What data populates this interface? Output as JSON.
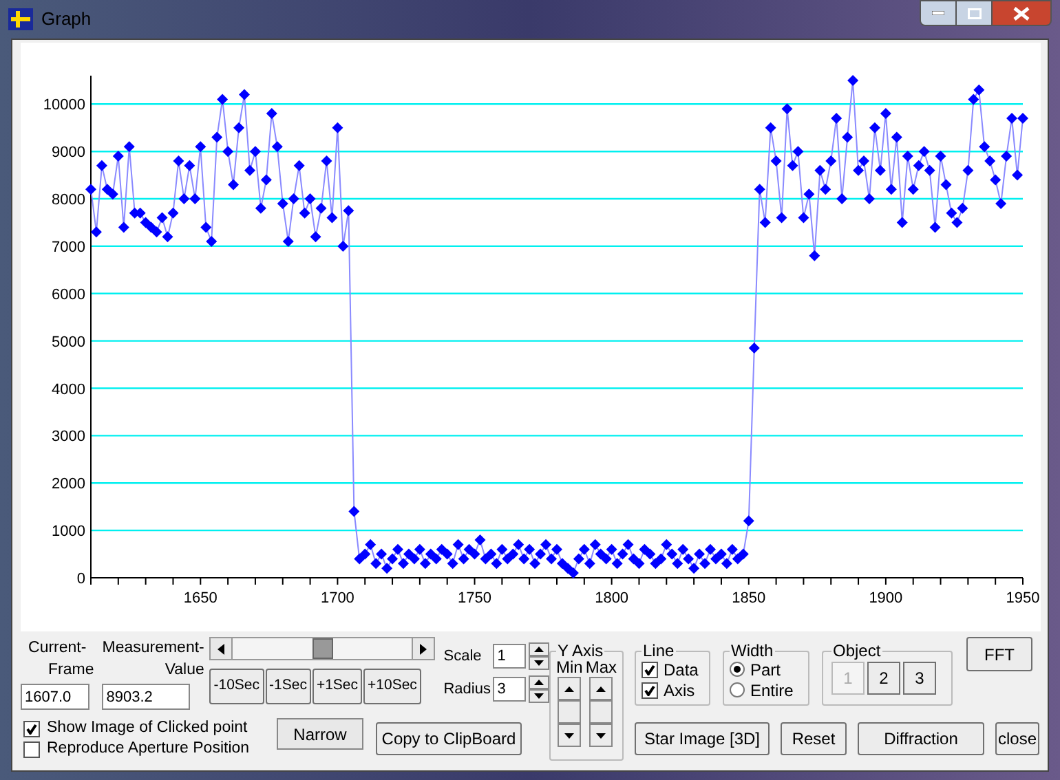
{
  "window": {
    "title": "Graph"
  },
  "graph": {
    "chart_data": {
      "type": "line",
      "grid": true,
      "xlim": [
        1610,
        1950
      ],
      "ylim": [
        0,
        10600
      ],
      "xticks": [
        1650,
        1700,
        1750,
        1800,
        1850,
        1900,
        1950
      ],
      "yticks": [
        0,
        1000,
        2000,
        3000,
        4000,
        5000,
        6000,
        7000,
        8000,
        9000,
        10000
      ],
      "x": [
        1610,
        1612,
        1614,
        1616,
        1618,
        1620,
        1622,
        1624,
        1626,
        1628,
        1630,
        1632,
        1634,
        1636,
        1638,
        1640,
        1642,
        1644,
        1646,
        1648,
        1650,
        1652,
        1654,
        1656,
        1658,
        1660,
        1662,
        1664,
        1666,
        1668,
        1670,
        1672,
        1674,
        1676,
        1678,
        1680,
        1682,
        1684,
        1686,
        1688,
        1690,
        1692,
        1694,
        1696,
        1698,
        1700,
        1702,
        1704,
        1706,
        1708,
        1710,
        1712,
        1714,
        1716,
        1718,
        1720,
        1722,
        1724,
        1726,
        1728,
        1730,
        1732,
        1734,
        1736,
        1738,
        1740,
        1742,
        1744,
        1746,
        1748,
        1750,
        1752,
        1754,
        1756,
        1758,
        1760,
        1762,
        1764,
        1766,
        1768,
        1770,
        1772,
        1774,
        1776,
        1778,
        1780,
        1782,
        1784,
        1786,
        1788,
        1790,
        1792,
        1794,
        1796,
        1798,
        1800,
        1802,
        1804,
        1806,
        1808,
        1810,
        1812,
        1814,
        1816,
        1818,
        1820,
        1822,
        1824,
        1826,
        1828,
        1830,
        1832,
        1834,
        1836,
        1838,
        1840,
        1842,
        1844,
        1846,
        1848,
        1850,
        1852,
        1854,
        1856,
        1858,
        1860,
        1862,
        1864,
        1866,
        1868,
        1870,
        1872,
        1874,
        1876,
        1878,
        1880,
        1882,
        1884,
        1886,
        1888,
        1890,
        1892,
        1894,
        1896,
        1898,
        1900,
        1902,
        1904,
        1906,
        1908,
        1910,
        1912,
        1914,
        1916,
        1918,
        1920,
        1922,
        1924,
        1926,
        1928,
        1930,
        1932,
        1934,
        1936,
        1938,
        1940,
        1942,
        1944,
        1946,
        1948,
        1950
      ],
      "series": [
        {
          "marker": "diamond",
          "color": "#0000ff",
          "values": [
            8200,
            7300,
            8700,
            8200,
            8100,
            8900,
            7400,
            9100,
            7700,
            7700,
            7500,
            7400,
            7300,
            7600,
            7200,
            7700,
            8800,
            8000,
            8700,
            8000,
            9100,
            7400,
            7100,
            9300,
            10100,
            9000,
            8300,
            9500,
            10200,
            8600,
            9000,
            7800,
            8400,
            9800,
            9100,
            7900,
            7100,
            8000,
            8700,
            7700,
            8000,
            7200,
            7800,
            8800,
            7600,
            9500,
            7000,
            7750,
            1400,
            400,
            500,
            700,
            300,
            500,
            200,
            400,
            600,
            300,
            500,
            400,
            600,
            300,
            500,
            400,
            600,
            500,
            300,
            700,
            400,
            600,
            500,
            800,
            400,
            500,
            300,
            600,
            400,
            500,
            700,
            400,
            600,
            300,
            500,
            700,
            400,
            600,
            300,
            200,
            100,
            400,
            600,
            300,
            700,
            500,
            400,
            600,
            300,
            500,
            700,
            400,
            300,
            600,
            500,
            300,
            400,
            700,
            500,
            300,
            600,
            400,
            200,
            500,
            300,
            600,
            400,
            500,
            300,
            600,
            400,
            500,
            1200,
            4850,
            8200,
            7500,
            9500,
            8800,
            7600,
            9900,
            8700,
            9000,
            7600,
            8100,
            6800,
            8600,
            8200,
            8800,
            9700,
            8000,
            9300,
            10500,
            8600,
            8800,
            8000,
            9500,
            8600,
            9800,
            8200,
            9300,
            7500,
            8900,
            8200,
            8700,
            9000,
            8600,
            7400,
            8900,
            8300,
            7700,
            7500,
            7800,
            8600,
            10100,
            10300,
            9100,
            8800,
            8400,
            7900,
            8900,
            9700,
            8500,
            9700
          ]
        }
      ]
    }
  },
  "frame": {
    "label": [
      "Current-",
      "Frame"
    ],
    "value": "1607.0"
  },
  "measurement": {
    "label": [
      "Measurement-",
      "Value"
    ],
    "value": "8903.2"
  },
  "step_buttons": [
    "-10Sec",
    "-1Sec",
    "+1Sec",
    "+10Sec"
  ],
  "scale": {
    "label": "Scale",
    "value": "1"
  },
  "radius": {
    "label": "Radius",
    "value": "3"
  },
  "checkboxes": [
    {
      "label": "Show Image of Clicked point",
      "checked": true
    },
    {
      "label": "Reproduce Aperture Position",
      "checked": false
    }
  ],
  "narrow_button": "Narrow",
  "copy_button": "Copy to ClipBoard",
  "y_axis": {
    "title": "Y Axis",
    "columns": [
      "Min",
      "Max"
    ]
  },
  "line": {
    "title": "Line",
    "options": [
      {
        "label": "Data",
        "checked": true
      },
      {
        "label": "Axis",
        "checked": true
      }
    ]
  },
  "width": {
    "title": "Width",
    "options": [
      {
        "label": "Part",
        "selected": true
      },
      {
        "label": "Entire",
        "selected": false
      }
    ]
  },
  "object": {
    "title": "Object",
    "buttons": [
      {
        "label": "1",
        "selected": true
      },
      {
        "label": "2",
        "selected": false
      },
      {
        "label": "3",
        "selected": false
      }
    ]
  },
  "fft_button": "FFT",
  "action_buttons": [
    "Star Image [3D]",
    "Reset",
    "Diffraction",
    "close"
  ]
}
